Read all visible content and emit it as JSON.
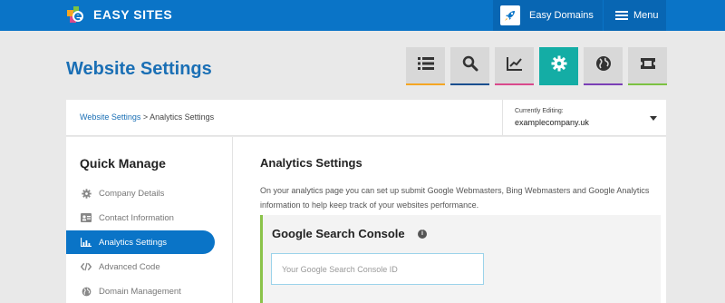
{
  "header": {
    "brand": "EASY SITES",
    "easy_domains_label": "Easy Domains",
    "menu_label": "Menu"
  },
  "page": {
    "title": "Website Settings"
  },
  "tabs": [
    {
      "icon": "list-icon",
      "accent": "#f5a623"
    },
    {
      "icon": "search-icon",
      "accent": "#1a4f8f"
    },
    {
      "icon": "chart-icon",
      "accent": "#d94a8c"
    },
    {
      "icon": "gear-icon",
      "accent": "#14ada5",
      "active": true
    },
    {
      "icon": "globe-icon",
      "accent": "#7b3fb6"
    },
    {
      "icon": "ticket-icon",
      "accent": "#7cc242"
    }
  ],
  "breadcrumb": {
    "link": "Website Settings",
    "separator": " > ",
    "current": "Analytics Settings"
  },
  "editing": {
    "label": "Currently Editing:",
    "site": "examplecompany.uk"
  },
  "sidebar": {
    "title": "Quick Manage",
    "items": [
      {
        "label": "Company Details",
        "icon": "gear-icon"
      },
      {
        "label": "Contact Information",
        "icon": "contact-card-icon"
      },
      {
        "label": "Analytics Settings",
        "icon": "bar-chart-icon",
        "active": true
      },
      {
        "label": "Advanced Code",
        "icon": "code-icon"
      },
      {
        "label": "Domain Management",
        "icon": "globe-icon"
      }
    ]
  },
  "main": {
    "title": "Analytics Settings",
    "description": "On your analytics page you can set up submit Google Webmasters, Bing Webmasters and Google Analytics information to help keep track of your websites performance.",
    "gsc": {
      "title": "Google Search Console",
      "info": "i",
      "placeholder": "Your Google Search Console ID",
      "value": ""
    }
  },
  "colors": {
    "brand_blue": "#0a74c7",
    "active_teal": "#14ada5",
    "gsc_accent": "#8bc34a"
  }
}
